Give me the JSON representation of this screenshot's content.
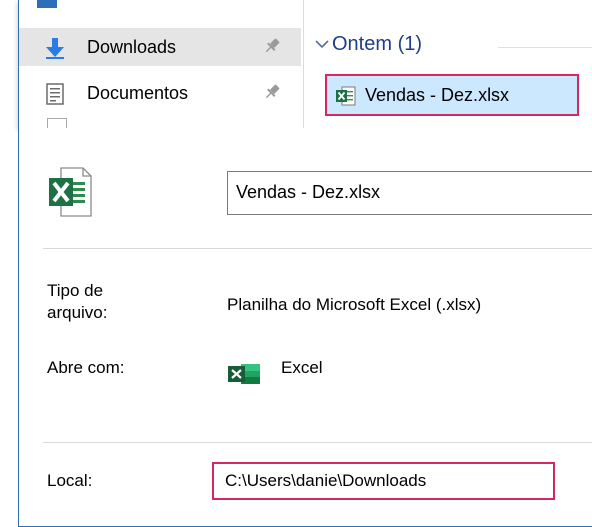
{
  "navigation": {
    "items": [
      {
        "label": "Downloads",
        "icon": "download-arrow-icon",
        "selected": true,
        "pinned": true
      },
      {
        "label": "Documentos",
        "icon": "documents-icon",
        "selected": false,
        "pinned": true
      }
    ]
  },
  "file_list": {
    "group_header": "Ontem (1)",
    "files": [
      {
        "name": "Vendas - Dez.xlsx",
        "icon": "excel-file-icon",
        "selected": true
      }
    ]
  },
  "properties": {
    "file_icon": "excel-file-large-icon",
    "file_name": "Vendas - Dez.xlsx",
    "type_label": "Tipo de arquivo:",
    "type_value": "Planilha do Microsoft Excel (.xlsx)",
    "opens_with_label": "Abre com:",
    "opens_with_icon": "excel-app-icon",
    "opens_with_value": "Excel",
    "location_label": "Local:",
    "location_value": "C:\\Users\\danie\\Downloads"
  },
  "colors": {
    "highlight_border": "#d6275f",
    "selection_background": "#cce8ff",
    "excel_green": "#107c41",
    "group_header_text": "#1e3e8a",
    "window_border": "#2f6fb7"
  }
}
